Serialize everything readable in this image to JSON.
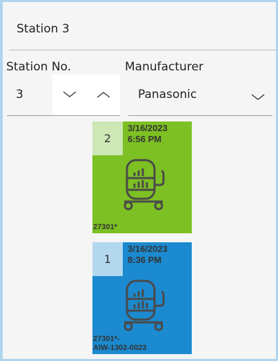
{
  "panel": {
    "title": "Station 3"
  },
  "station_no": {
    "label": "Station No.",
    "value": "3"
  },
  "manufacturer": {
    "label": "Manufacturer",
    "value": "Panasonic"
  },
  "cards": [
    {
      "number": "2",
      "date": "3/16/2023",
      "time": "6:56 PM",
      "id": "27301*",
      "color": "#7dc023",
      "badge_color": "#cde7b7"
    },
    {
      "number": "1",
      "date": "3/16/2023",
      "time": "8:36 PM",
      "id": "27301*-\nAIW-1302-0023",
      "color": "#1b8ad0",
      "badge_color": "#b3d8ee"
    }
  ],
  "icons": {
    "decrement": "chevron-down-icon",
    "increment": "chevron-up-icon",
    "dropdown": "chevron-down-icon",
    "card": "feeder-cart-icon"
  }
}
